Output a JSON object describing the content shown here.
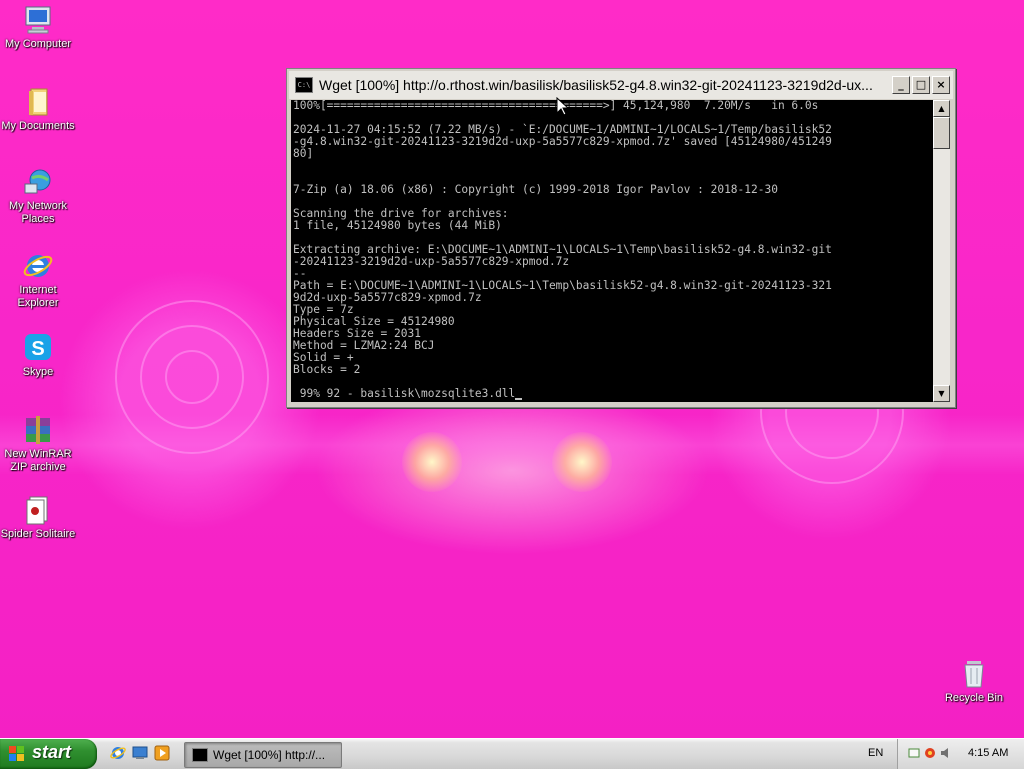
{
  "desktop": {
    "icons": [
      {
        "label": "My Computer"
      },
      {
        "label": "My Documents"
      },
      {
        "label": "My Network Places"
      },
      {
        "label": "Internet Explorer"
      },
      {
        "label": "Skype"
      },
      {
        "label": "New WinRAR ZIP archive"
      },
      {
        "label": "Spider Solitaire"
      },
      {
        "label": "Recycle Bin"
      }
    ]
  },
  "window": {
    "title": "Wget [100%] http://o.rthost.win/basilisk/basilisk52-g4.8.win32-git-20241123-3219d2d-ux...",
    "controls": {
      "minimize": "_",
      "maximize": "□",
      "close": "×"
    },
    "console_lines": [
      "100%[=========================================>] 45,124,980  7.20M/s   in 6.0s",
      "",
      "2024-11-27 04:15:52 (7.22 MB/s) - `E:/DOCUME~1/ADMINI~1/LOCALS~1/Temp/basilisk52",
      "-g4.8.win32-git-20241123-3219d2d-uxp-5a5577c829-xpmod.7z' saved [45124980/451249",
      "80]",
      "",
      "",
      "7-Zip (a) 18.06 (x86) : Copyright (c) 1999-2018 Igor Pavlov : 2018-12-30",
      "",
      "Scanning the drive for archives:",
      "1 file, 45124980 bytes (44 MiB)",
      "",
      "Extracting archive: E:\\DOCUME~1\\ADMINI~1\\LOCALS~1\\Temp\\basilisk52-g4.8.win32-git",
      "-20241123-3219d2d-uxp-5a5577c829-xpmod.7z",
      "--",
      "Path = E:\\DOCUME~1\\ADMINI~1\\LOCALS~1\\Temp\\basilisk52-g4.8.win32-git-20241123-321",
      "9d2d-uxp-5a5577c829-xpmod.7z",
      "Type = 7z",
      "Physical Size = 45124980",
      "Headers Size = 2031",
      "Method = LZMA2:24 BCJ",
      "Solid = +",
      "Blocks = 2",
      "",
      " 99% 92 - basilisk\\mozsqlite3.dll"
    ]
  },
  "taskbar": {
    "start_label": "start",
    "task_label": "Wget [100%] http://...",
    "language": "EN",
    "clock": "4:15 AM"
  },
  "colors": {
    "desktop_bg": "#f826c9",
    "console_bg": "#000000",
    "console_fg": "#c0c0c0",
    "start_green": "#2f8f2f"
  }
}
